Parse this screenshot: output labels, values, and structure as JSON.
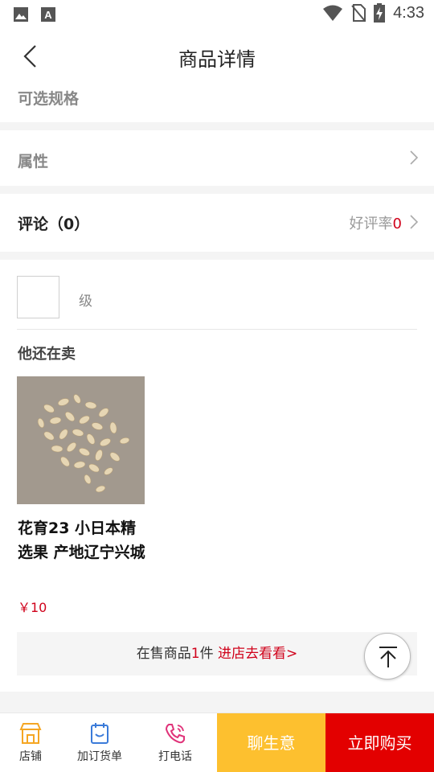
{
  "status_bar": {
    "time": "4:33"
  },
  "header": {
    "title": "商品详情"
  },
  "spec": {
    "label": "可选规格"
  },
  "attributes": {
    "label": "属性"
  },
  "reviews": {
    "label": "评论（0）",
    "rate_label": "好评率",
    "rate_value": "0"
  },
  "shop": {
    "level_label": "级"
  },
  "also_selling": {
    "title": "他还在卖",
    "items": [
      {
        "name": "花育23 小日本精选果 产地辽宁兴城",
        "price": "￥10"
      }
    ]
  },
  "on_sale": {
    "prefix": "在售商品",
    "count": "1",
    "suffix": "件",
    "link": "进店去看看>"
  },
  "bottom_bar": {
    "shop": "店铺",
    "add_order": "加订货单",
    "call": "打电话",
    "chat": "聊生意",
    "buy": "立即购买"
  },
  "colors": {
    "accent_red": "#d0021b",
    "buy_red": "#e30000",
    "chat_yellow": "#fdc02f"
  }
}
